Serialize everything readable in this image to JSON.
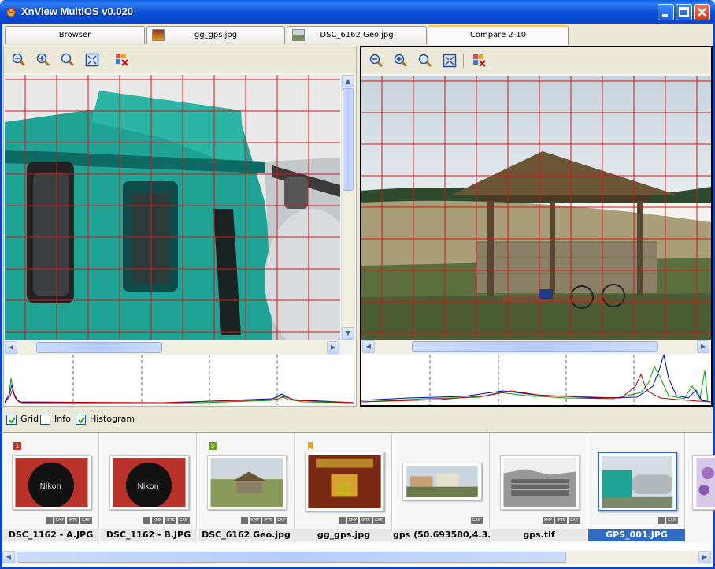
{
  "window": {
    "title": "XnView MultiOS v0.020"
  },
  "tabs": [
    {
      "label": "Browser",
      "has_thumb": false
    },
    {
      "label": "gg_gps.jpg",
      "has_thumb": true
    },
    {
      "label": "DSC_6162 Geo.jpg",
      "has_thumb": true
    },
    {
      "label": "Compare 2-10",
      "active": true
    }
  ],
  "toolbar": {
    "buttons": [
      "zoom-out-icon",
      "zoom-in-icon",
      "zoom-actual-icon",
      "fit-window-icon",
      "close-compare-icon"
    ]
  },
  "options": {
    "grid": {
      "label": "Grid",
      "checked": true
    },
    "info": {
      "label": "Info",
      "checked": false
    },
    "histogram": {
      "label": "Histogram",
      "checked": true
    }
  },
  "filmstrip": {
    "items": [
      {
        "name": "DSC_1162 - A.JPG",
        "flag": "1",
        "flag_color": "#c0392b",
        "badges": [
          "sq",
          "XMP",
          "IPTC",
          "EXIF"
        ],
        "selected": false
      },
      {
        "name": "DSC_1162 - B.JPG",
        "flag": "",
        "badges": [
          "sq",
          "XMP",
          "IPTC",
          "EXIF"
        ],
        "selected": false
      },
      {
        "name": "DSC_6162 Geo.jpg",
        "flag": "3",
        "flag_color": "#6aa121",
        "badges": [
          "sq",
          "XMP",
          "IPTC",
          "EXIF"
        ],
        "selected": false
      },
      {
        "name": "gg_gps.jpg",
        "flag": "bookmark",
        "flag_color": "#f0a020",
        "badges": [
          "sq",
          "XMP",
          "IPTC",
          "EXIF"
        ],
        "selected": false
      },
      {
        "name": "gps (50.693580,4.3...",
        "flag": "",
        "badges": [
          "EXIF"
        ],
        "selected": false
      },
      {
        "name": "gps.tif",
        "flag": "",
        "badges": [
          "XMP",
          "IPTC",
          "EXIF"
        ],
        "selected": false
      },
      {
        "name": "GPS_001.JPG",
        "flag": "",
        "badges": [
          "sq",
          "EXIF"
        ],
        "selected": true
      }
    ]
  },
  "colors": {
    "grid": "#d01818",
    "title_bar": "#0a4fd5",
    "selection": "#316ac5"
  }
}
